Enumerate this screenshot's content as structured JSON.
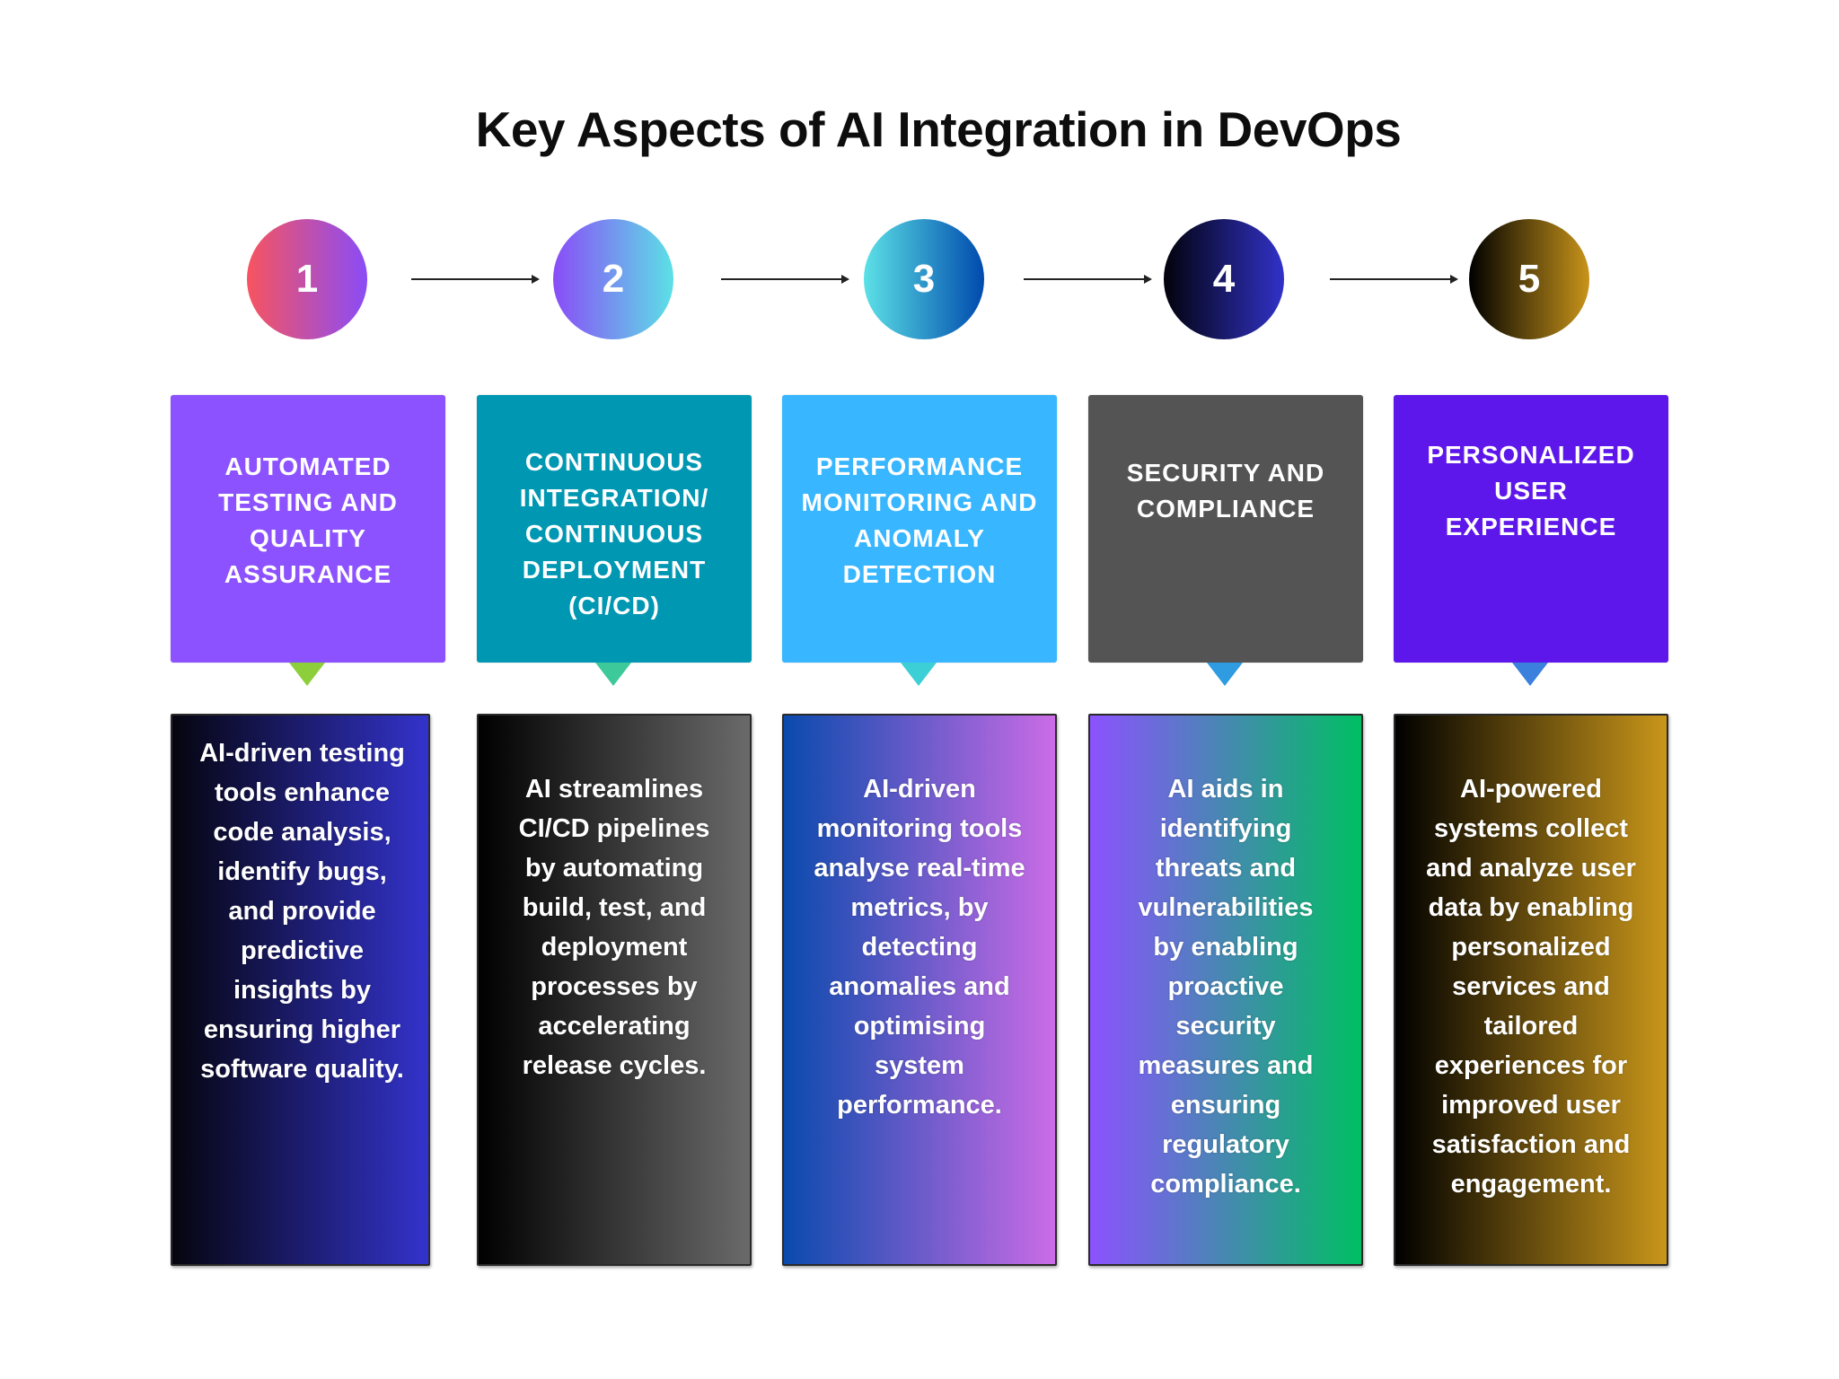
{
  "title": "Key Aspects of AI Integration in DevOps",
  "steps": [
    {
      "number": "1",
      "heading": "AUTOMATED TESTING AND QUALITY ASSURANCE",
      "description": "AI-driven testing tools enhance code analysis, identify bugs, and provide predictive insights by ensuring higher software quality.",
      "circle_gradient": [
        "#f7545f",
        "#8a4cf7"
      ],
      "header_color": "#8c52ff",
      "pointer_color": "#8ccf3a",
      "desc_gradient": [
        "#05050f",
        "#3333cc"
      ]
    },
    {
      "number": "2",
      "heading": "CONTINUOUS INTEGRATION/ CONTINUOUS DEPLOYMENT (CI/CD)",
      "description": "AI streamlines CI/CD pipelines by automating build, test, and deployment processes by accelerating release cycles.",
      "circle_gradient": [
        "#8a4cf7",
        "#5ce1e6"
      ],
      "header_color": "#0097b2",
      "pointer_color": "#3ec99a",
      "desc_gradient": [
        "#000000",
        "#6a6a6a"
      ]
    },
    {
      "number": "3",
      "heading": "PERFORMANCE MONITORING AND ANOMALY DETECTION",
      "description": "AI-driven monitoring tools analyse real-time metrics, by detecting anomalies and optimising system performance.",
      "circle_gradient": [
        "#5ce1e6",
        "#004aad"
      ],
      "header_color": "#38b6ff",
      "pointer_color": "#3ccfd6",
      "desc_gradient": [
        "#0a4aad",
        "#cb6ce6"
      ]
    },
    {
      "number": "4",
      "heading": "SECURITY AND COMPLIANCE",
      "description": "AI aids in identifying threats and vulnerabilities by enabling proactive security measures and ensuring regulatory compliance.",
      "circle_gradient": [
        "#02020c",
        "#3132c8"
      ],
      "header_color": "#545454",
      "pointer_color": "#2f9be0",
      "desc_gradient": [
        "#8c52ff",
        "#00bf63"
      ]
    },
    {
      "number": "5",
      "heading": "PERSONALIZED USER EXPERIENCE",
      "description": "AI-powered systems collect and analyze user data by enabling personalized services and tailored experiences for improved user satisfaction and engagement.",
      "circle_gradient": [
        "#000000",
        "#c8941a"
      ],
      "header_color": "#5e17eb",
      "pointer_color": "#3a80dc",
      "desc_gradient": [
        "#000000",
        "#c9961a"
      ]
    }
  ]
}
